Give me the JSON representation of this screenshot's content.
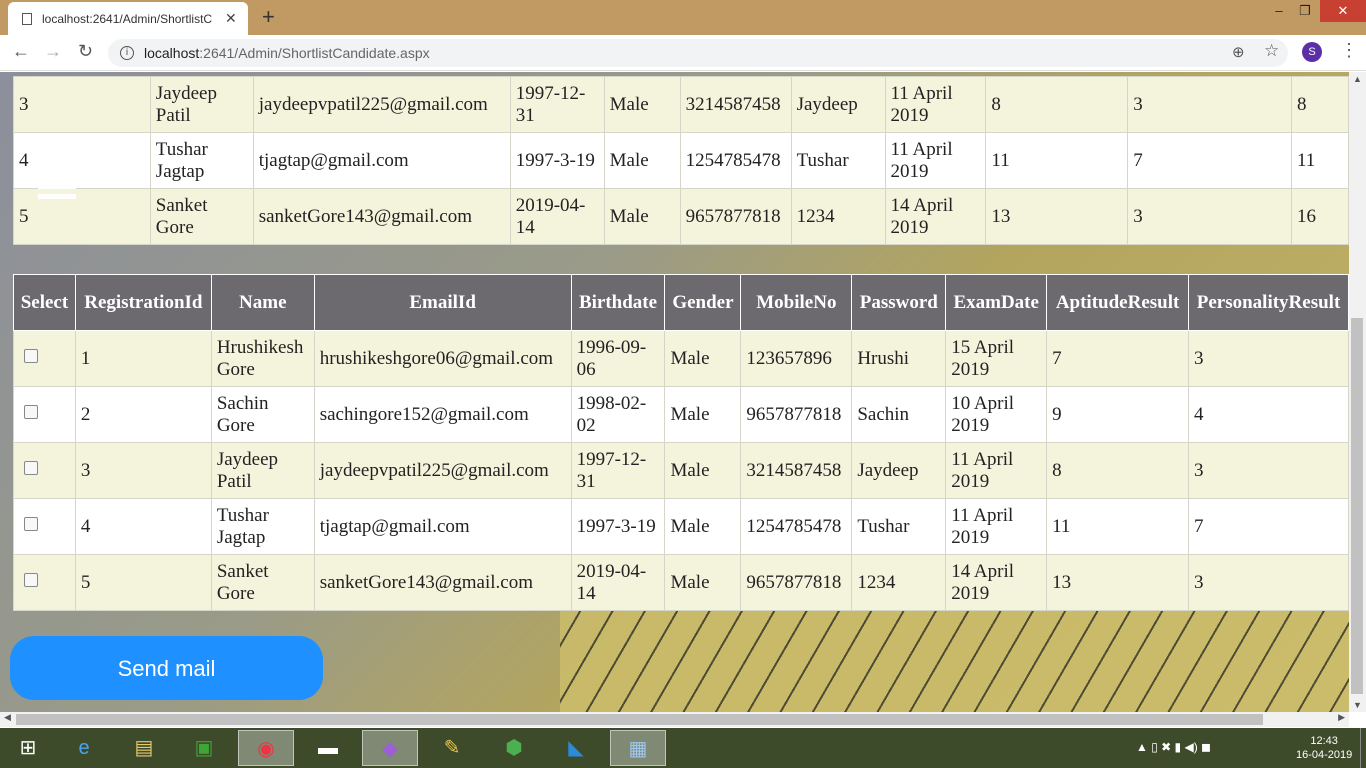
{
  "browser": {
    "tab_title": "localhost:2641/Admin/ShortlistC",
    "url_host": "localhost",
    "url_rest": ":2641/Admin/ShortlistCandidate.aspx",
    "avatar_letter": "S",
    "new_tab": "+",
    "min": "–",
    "restore": "❐",
    "close": "✕"
  },
  "top_table": {
    "rows": [
      [
        "3",
        "Jaydeep Patil",
        "jaydeepvpatil225@gmail.com",
        "1997-12-31",
        "Male",
        "3214587458",
        "Jaydeep",
        "11 April 2019",
        "8",
        "3",
        "8"
      ],
      [
        "4",
        "Tushar Jagtap",
        "tjagtap@gmail.com",
        "1997-3-19",
        "Male",
        "1254785478",
        "Tushar",
        "11 April 2019",
        "11",
        "7",
        "11"
      ],
      [
        "5",
        "Sanket Gore",
        "sanketGore143@gmail.com",
        "2019-04-14",
        "Male",
        "9657877818",
        "1234",
        "14 April 2019",
        "13",
        "3",
        "16"
      ]
    ]
  },
  "main_table": {
    "headers": [
      "Select",
      "RegistrationId",
      "Name",
      "EmailId",
      "Birthdate",
      "Gender",
      "MobileNo",
      "Password",
      "ExamDate",
      "AptitudeResult",
      "PersonalityResult"
    ],
    "rows": [
      [
        "1",
        "Hrushikesh Gore",
        "hrushikeshgore06@gmail.com",
        "1996-09-06",
        "Male",
        "123657896",
        "Hrushi",
        "15 April 2019",
        "7",
        "3"
      ],
      [
        "2",
        "Sachin Gore",
        "sachingore152@gmail.com",
        "1998-02-02",
        "Male",
        "9657877818",
        "Sachin",
        "10 April 2019",
        "9",
        "4"
      ],
      [
        "3",
        "Jaydeep Patil",
        "jaydeepvpatil225@gmail.com",
        "1997-12-31",
        "Male",
        "3214587458",
        "Jaydeep",
        "11 April 2019",
        "8",
        "3"
      ],
      [
        "4",
        "Tushar Jagtap",
        "tjagtap@gmail.com",
        "1997-3-19",
        "Male",
        "1254785478",
        "Tushar",
        "11 April 2019",
        "11",
        "7"
      ],
      [
        "5",
        "Sanket Gore",
        "sanketGore143@gmail.com",
        "2019-04-14",
        "Male",
        "9657877818",
        "1234",
        "14 April 2019",
        "13",
        "3"
      ]
    ]
  },
  "send_mail_label": "Send mail",
  "taskbar": {
    "time": "12:43",
    "date": "16-04-2019"
  },
  "colors": {
    "header_bg": "#6d6a6f",
    "row_odd": "#f4f4dd",
    "button_bg": "#1e90ff"
  }
}
